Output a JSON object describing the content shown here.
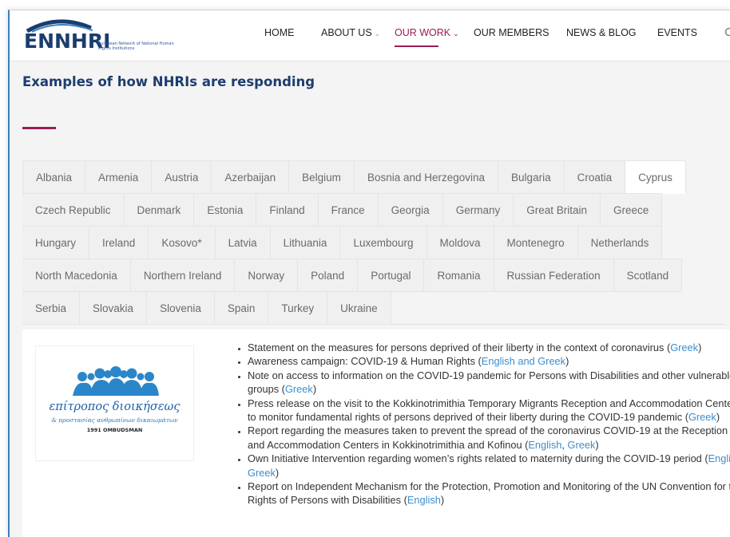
{
  "brand": {
    "name": "ENNHRI",
    "subtitle": "European Network of National Human Rights Institutions",
    "colors": {
      "navy": "#1d3d6e",
      "accent": "#9b1c55",
      "link": "#3a8ed0"
    }
  },
  "nav": {
    "items": [
      {
        "label": "HOME",
        "caret": false,
        "active": false
      },
      {
        "label": "ABOUT US",
        "caret": true,
        "active": false
      },
      {
        "label": "OUR WORK",
        "caret": true,
        "active": true
      },
      {
        "label": "OUR MEMBERS",
        "caret": false,
        "active": false
      },
      {
        "label": "NEWS & BLOG",
        "caret": false,
        "active": false
      },
      {
        "label": "EVENTS",
        "caret": false,
        "active": false
      }
    ],
    "search_icon": "search-icon"
  },
  "page": {
    "title": "Examples of how NHRIs are responding"
  },
  "tabs": [
    "Albania",
    "Armenia",
    "Austria",
    "Azerbaijan",
    "Belgium",
    "Bosnia and Herzegovina",
    "Bulgaria",
    "Croatia",
    "Cyprus",
    "Czech Republic",
    "Denmark",
    "Estonia",
    "Finland",
    "France",
    "Georgia",
    "Germany",
    "Great Britain",
    "Greece",
    "Hungary",
    "Ireland",
    "Kosovo*",
    "Latvia",
    "Lithuania",
    "Luxembourg",
    "Moldova",
    "Montenegro",
    "Netherlands",
    "North Macedonia",
    "Northern Ireland",
    "Norway",
    "Poland",
    "Portugal",
    "Romania",
    "Russian Federation",
    "Scotland",
    "Serbia",
    "Slovakia",
    "Slovenia",
    "Spain",
    "Turkey",
    "Ukraine"
  ],
  "selected_tab": "Cyprus",
  "org": {
    "line1": "επίτροπος διοικήσεως",
    "line2": "& προστασίας ανθρωπίνων δικαιωμάτων",
    "year": "1991 OMBUDSMAN"
  },
  "items": [
    {
      "text": "Statement on the measures for persons deprived of their liberty in the context of coronavirus (",
      "links": [
        "Greek"
      ],
      "after": ")"
    },
    {
      "text": "Awareness campaign: COVID-19 & Human Rights (",
      "links": [
        "English and Greek"
      ],
      "after": ")"
    },
    {
      "text": "Note on access to information on the COVID-19 pandemic for Persons with Disabilities and other vulnerable groups (",
      "links": [
        "Greek"
      ],
      "after": ")"
    },
    {
      "text": "Press release on the visit to the Kokkinotrimithia Temporary Migrants Reception and Accommodation Center to monitor fundamental rights of persons deprived of their liberty during the COVID-19 pandemic (",
      "links": [
        "Greek"
      ],
      "after": ")"
    },
    {
      "text": "Report regarding the measures taken to prevent the spread of the coronavirus COVID-19 at the Reception and Accommodation Centers in Kokkinotrimithia and Kofinou (",
      "links": [
        "English",
        "Greek"
      ],
      "after": ")"
    },
    {
      "text": "Own Initiative Intervention regarding women’s rights related to maternity during the COVID-19 period (",
      "links": [
        "English",
        "Greek"
      ],
      "after": ")"
    },
    {
      "text": "Report on Independent Mechanism for the Protection, Promotion and Monitoring of the UN Convention for the Rights of Persons with Disabilities (",
      "links": [
        "English"
      ],
      "after": ")"
    }
  ]
}
